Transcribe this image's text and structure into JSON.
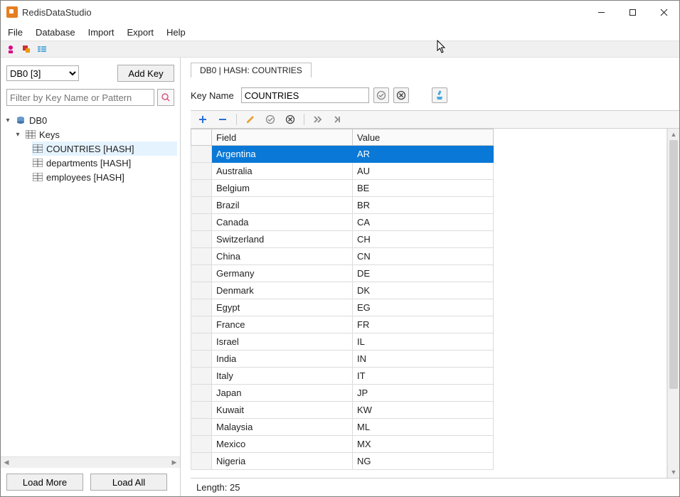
{
  "window": {
    "title": "RedisDataStudio"
  },
  "menu": {
    "file": "File",
    "database": "Database",
    "import": "Import",
    "export": "Export",
    "help": "Help"
  },
  "sidebar": {
    "db_select": "DB0 [3]",
    "add_key": "Add Key",
    "filter_placeholder": "Filter by Key Name or Pattern",
    "root": "DB0",
    "keys_label": "Keys",
    "items": [
      {
        "label": "COUNTRIES [HASH]",
        "selected": true
      },
      {
        "label": "departments [HASH]",
        "selected": false
      },
      {
        "label": "employees [HASH]",
        "selected": false
      }
    ],
    "load_more": "Load More",
    "load_all": "Load All"
  },
  "tab": {
    "label": "DB0 | HASH: COUNTRIES"
  },
  "keyname": {
    "label": "Key Name",
    "value": "COUNTRIES"
  },
  "grid": {
    "field_header": "Field",
    "value_header": "Value",
    "rows": [
      {
        "field": "Argentina",
        "value": "AR",
        "selected": true
      },
      {
        "field": "Australia",
        "value": "AU"
      },
      {
        "field": "Belgium",
        "value": "BE"
      },
      {
        "field": "Brazil",
        "value": "BR"
      },
      {
        "field": "Canada",
        "value": "CA"
      },
      {
        "field": "Switzerland",
        "value": "CH"
      },
      {
        "field": "China",
        "value": "CN"
      },
      {
        "field": "Germany",
        "value": "DE"
      },
      {
        "field": "Denmark",
        "value": "DK"
      },
      {
        "field": "Egypt",
        "value": "EG"
      },
      {
        "field": "France",
        "value": "FR"
      },
      {
        "field": "Israel",
        "value": "IL"
      },
      {
        "field": "India",
        "value": "IN"
      },
      {
        "field": "Italy",
        "value": "IT"
      },
      {
        "field": "Japan",
        "value": "JP"
      },
      {
        "field": "Kuwait",
        "value": "KW"
      },
      {
        "field": "Malaysia",
        "value": "ML"
      },
      {
        "field": "Mexico",
        "value": "MX"
      },
      {
        "field": "Nigeria",
        "value": "NG"
      }
    ]
  },
  "status": {
    "length_label": "Length: 25"
  }
}
